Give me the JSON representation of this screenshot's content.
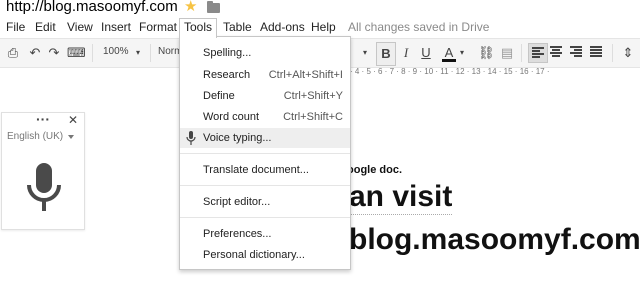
{
  "header": {
    "doc_title": "http://blog.masoomyf.com",
    "star_icon": "star-icon",
    "folder_icon": "folder-icon",
    "save_status": "All changes saved in Drive"
  },
  "menubar": {
    "items": [
      "File",
      "Edit",
      "View",
      "Insert",
      "Format",
      "Tools",
      "Table",
      "Add-ons",
      "Help"
    ],
    "active": "Tools"
  },
  "toolbar": {
    "zoom": "100%",
    "style": "Norm",
    "bold": "B",
    "italic": "I",
    "underline": "U",
    "text_color": "A"
  },
  "ruler": {
    "marks": "· 4 · 5 · 6 · 7 · 8 · 9 · 10 · 11 · 12 · 13 · 14 · 15 · 16 · 17 ·"
  },
  "tools_menu": {
    "items": [
      {
        "label": "Spelling...",
        "shortcut": ""
      },
      {
        "label": "Research",
        "shortcut": "Ctrl+Alt+Shift+I"
      },
      {
        "label": "Define",
        "shortcut": "Ctrl+Shift+Y"
      },
      {
        "label": "Word count",
        "shortcut": "Ctrl+Shift+C"
      },
      {
        "label": "Voice typing...",
        "shortcut": ""
      },
      {
        "label": "Translate document...",
        "shortcut": ""
      },
      {
        "label": "Script editor...",
        "shortcut": ""
      },
      {
        "label": "Preferences...",
        "shortcut": ""
      },
      {
        "label": "Personal dictionary...",
        "shortcut": ""
      }
    ],
    "highlighted": "Voice typing..."
  },
  "voice_widget": {
    "dots": "···",
    "close": "✕",
    "language": "English (UK)"
  },
  "document": {
    "line1": "oogle doc.",
    "line2": "an visit",
    "line3": "blog.masoomyf.com"
  }
}
